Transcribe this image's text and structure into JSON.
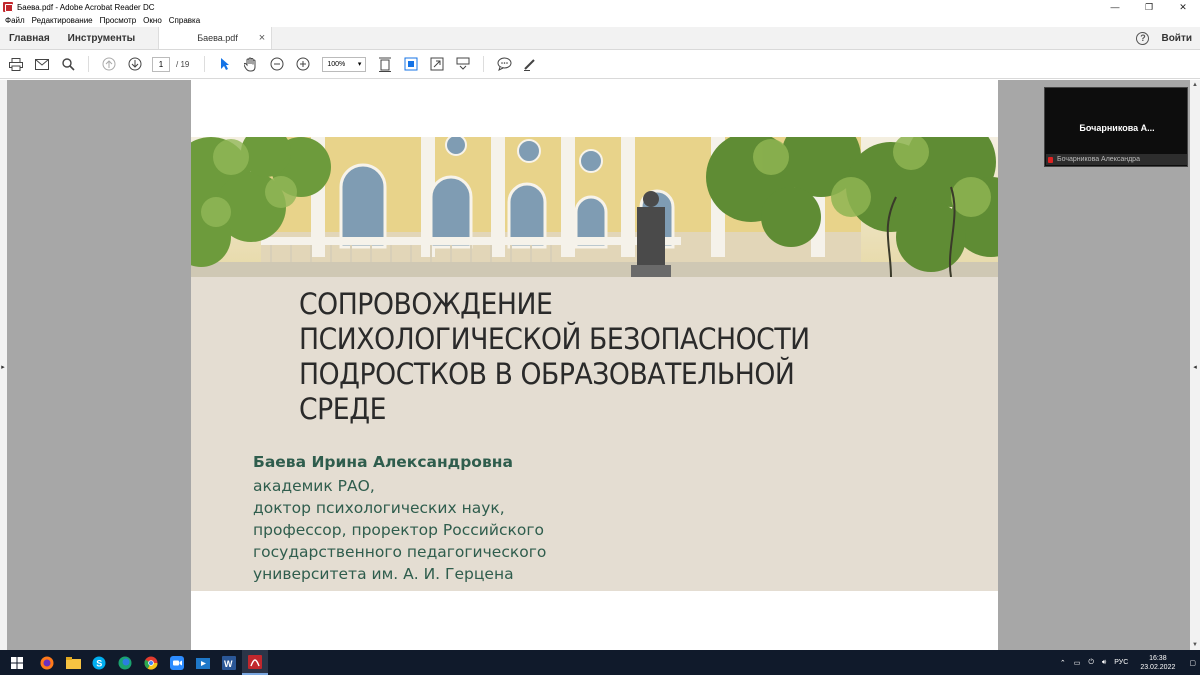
{
  "window": {
    "title": "Баева.pdf - Adobe Acrobat Reader DC",
    "minimize": "—",
    "maximize": "❐",
    "close": "✕"
  },
  "menu": [
    "Файл",
    "Редактирование",
    "Просмотр",
    "Окно",
    "Справка"
  ],
  "tabs": {
    "home": "Главная",
    "tools": "Инструменты",
    "document": "Баева.pdf",
    "document_close": "×",
    "help": "?",
    "sign_in": "Войти"
  },
  "toolbar": {
    "page_current": "1",
    "page_total": "/ 19",
    "zoom": "100%",
    "zoom_arrow": "▾"
  },
  "slide": {
    "title_lines": [
      "СОПРОВОЖДЕНИЕ",
      "ПСИХОЛОГИЧЕСКОЙ БЕЗОПАСНОСТИ",
      "ПОДРОСТКОВ В ОБРАЗОВАТЕЛЬНОЙ",
      "СРЕДЕ"
    ],
    "author": "Баева Ирина Александровна",
    "author_desc": [
      "академик РАО,",
      "доктор психологических наук,",
      "профессор, проректор Российского",
      "государственного педагогического",
      "университета им. А. И. Герцена"
    ]
  },
  "video": {
    "name_big": "Бочарникова  А...",
    "caption": "Бочарникова Александра"
  },
  "taskbar": {
    "language": "РУС",
    "time": "16:38",
    "date": "23.02.2022"
  },
  "colors": {
    "slide_band": "#e4ddd2",
    "author_green": "#2f5d4d",
    "taskbar": "#101a2b",
    "doc_background": "#a7a7a7"
  }
}
